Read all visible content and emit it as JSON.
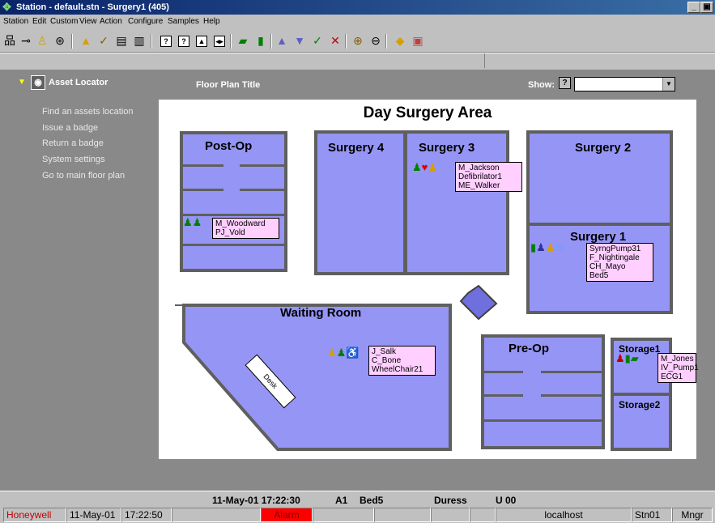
{
  "window": {
    "title": "Station - default.stn - Surgery1 (405)"
  },
  "menu": [
    "Station",
    "Edit",
    "Custom",
    "View",
    "Action",
    "Configure",
    "Samples",
    "Help"
  ],
  "toolbar": {
    "help_glyphs": [
      "?",
      "?",
      "▲",
      "◂▸"
    ]
  },
  "sidebar": {
    "title": "Asset Locator",
    "items": [
      "Find an assets location",
      "Issue a badge",
      "Return a badge",
      "System settings",
      "Go to main floor plan"
    ]
  },
  "header": {
    "floor_plan_title": "Floor Plan Title",
    "show_label": "Show:",
    "help": "?",
    "show_value": ""
  },
  "floorplan": {
    "title": "Day Surgery Area",
    "rooms": {
      "postop": "Post-Op",
      "surgery4": "Surgery 4",
      "surgery3": "Surgery 3",
      "surgery2": "Surgery 2",
      "surgery1": "Surgery 1",
      "waiting": "Waiting Room",
      "preop": "Pre-Op",
      "storage1": "Storage1",
      "storage2": "Storage2",
      "desk": "Desk"
    },
    "tags": {
      "surgery3": [
        "M_Jackson",
        "Defibrilator1",
        "ME_Walker"
      ],
      "postop": [
        "M_Woodward",
        "PJ_Vold"
      ],
      "surgery1": [
        "SyrngPump31",
        "F_Nightingale",
        "CH_Mayo",
        "Bed5"
      ],
      "waiting": [
        "J_Salk",
        "C_Bone",
        "WheelChair21"
      ],
      "storage1": [
        "M_Jones",
        "IV_Pump1",
        "ECG1"
      ]
    }
  },
  "status": {
    "datetime": "11-May-01 17:22:30",
    "location": "A1",
    "bed": "Bed5",
    "event": "Duress",
    "unit": "U 00"
  },
  "statusbar": {
    "brand": "Honeywell",
    "date": "11-May-01",
    "time": "17:22:50",
    "alarm": "Alarm",
    "host": "localhost",
    "station": "Stn01",
    "role": "Mngr"
  },
  "colors": {
    "room_fill": "#9595f5",
    "wall": "#5f5f5f",
    "tag_fill": "#ffcfff",
    "alarm": "#ff0000",
    "brand": "#c00000"
  }
}
